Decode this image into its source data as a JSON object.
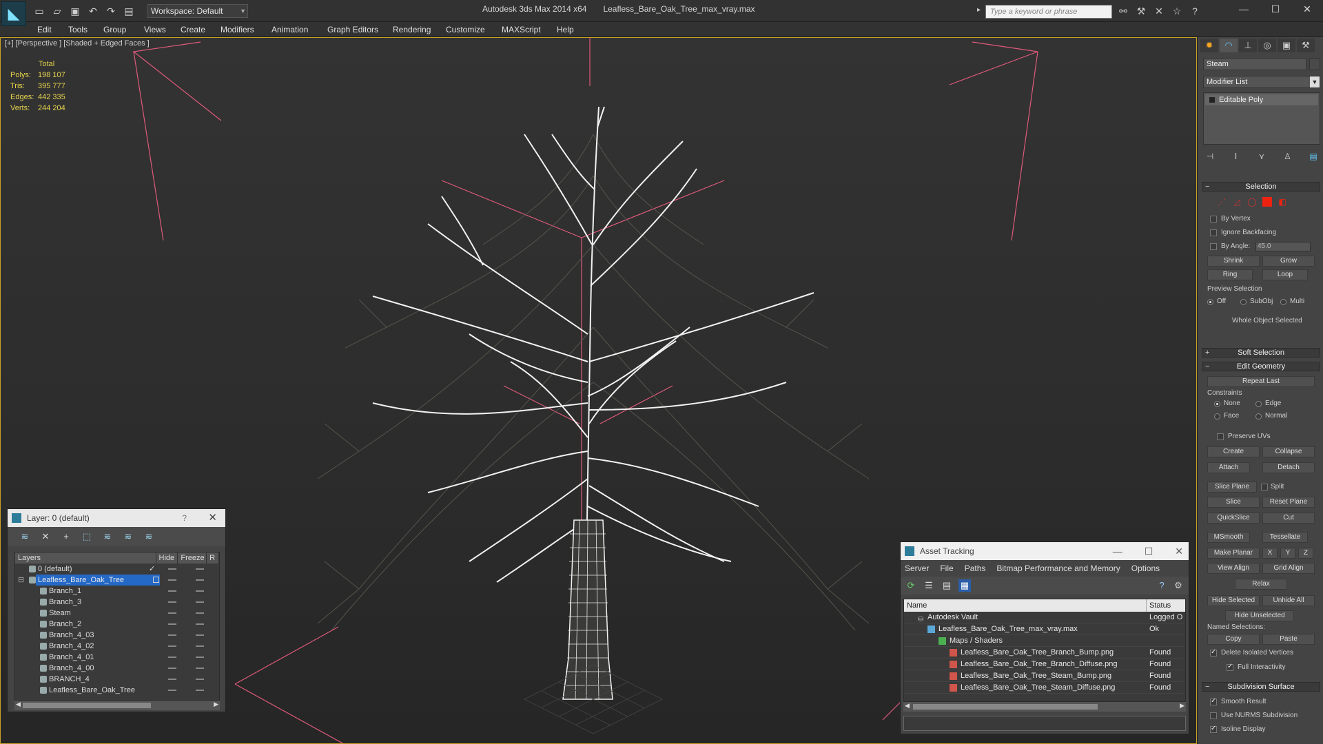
{
  "app": {
    "title": "Autodesk 3ds Max 2014 x64",
    "file": "Leafless_Bare_Oak_Tree_max_vray.max",
    "workspace": "Workspace: Default",
    "search_placeholder": "Type a keyword or phrase"
  },
  "menu": [
    "Edit",
    "Tools",
    "Group",
    "Views",
    "Create",
    "Modifiers",
    "Animation",
    "Graph Editors",
    "Rendering",
    "Customize",
    "MAXScript",
    "Help"
  ],
  "viewport": {
    "label": "[+] [Perspective ] [Shaded + Edged Faces ]",
    "stats": {
      "header": "Total",
      "rows": [
        {
          "k": "Polys:",
          "v": "198 107"
        },
        {
          "k": "Tris:",
          "v": "395 777"
        },
        {
          "k": "Edges:",
          "v": "442 335"
        },
        {
          "k": "Verts:",
          "v": "244 204"
        }
      ]
    }
  },
  "layer_panel": {
    "title": "Layer: 0 (default)",
    "help": "?",
    "columns": [
      "Layers",
      "Hide",
      "Freeze",
      "R"
    ],
    "rows": [
      {
        "name": "0 (default)",
        "level": 1,
        "selected": false
      },
      {
        "name": "Leafless_Bare_Oak_Tree",
        "level": 1,
        "selected": true
      },
      {
        "name": "Branch_1",
        "level": 2,
        "selected": false
      },
      {
        "name": "Branch_3",
        "level": 2,
        "selected": false
      },
      {
        "name": "Steam",
        "level": 2,
        "selected": false
      },
      {
        "name": "Branch_2",
        "level": 2,
        "selected": false
      },
      {
        "name": "Branch_4_03",
        "level": 2,
        "selected": false
      },
      {
        "name": "Branch_4_02",
        "level": 2,
        "selected": false
      },
      {
        "name": "Branch_4_01",
        "level": 2,
        "selected": false
      },
      {
        "name": "Branch_4_00",
        "level": 2,
        "selected": false
      },
      {
        "name": "BRANCH_4",
        "level": 2,
        "selected": false
      },
      {
        "name": "Leafless_Bare_Oak_Tree",
        "level": 2,
        "selected": false
      }
    ]
  },
  "asset_panel": {
    "title": "Asset Tracking",
    "menu": [
      "Server",
      "File",
      "Paths",
      "Bitmap Performance and Memory",
      "Options"
    ],
    "columns": [
      "Name",
      "Status"
    ],
    "rows": [
      {
        "name": "Autodesk Vault",
        "status": "Logged O",
        "level": 1
      },
      {
        "name": "Leafless_Bare_Oak_Tree_max_vray.max",
        "status": "Ok",
        "level": 2
      },
      {
        "name": "Maps / Shaders",
        "status": "",
        "level": 3
      },
      {
        "name": "Leafless_Bare_Oak_Tree_Branch_Bump.png",
        "status": "Found",
        "level": 4
      },
      {
        "name": "Leafless_Bare_Oak_Tree_Branch_Diffuse.png",
        "status": "Found",
        "level": 4
      },
      {
        "name": "Leafless_Bare_Oak_Tree_Steam_Bump.png",
        "status": "Found",
        "level": 4
      },
      {
        "name": "Leafless_Bare_Oak_Tree_Steam_Diffuse.png",
        "status": "Found",
        "level": 4
      }
    ]
  },
  "command_panel": {
    "object_name": "Steam",
    "modifier_list": "Modifier List",
    "stack_item": "Editable Poly",
    "selection": {
      "header": "Selection",
      "by_vertex": "By Vertex",
      "ignore_backfacing": "Ignore Backfacing",
      "by_angle": "By Angle:",
      "angle_value": "45.0",
      "shrink": "Shrink",
      "grow": "Grow",
      "ring": "Ring",
      "loop": "Loop",
      "preview_selection": "Preview Selection",
      "preview_off": "Off",
      "preview_subobj": "SubObj",
      "preview_multi": "Multi",
      "status": "Whole Object Selected"
    },
    "soft_selection": "Soft Selection",
    "edit_geometry": {
      "header": "Edit Geometry",
      "repeat_last": "Repeat Last",
      "constraints": "Constraints",
      "none": "None",
      "edge": "Edge",
      "face": "Face",
      "normal": "Normal",
      "preserve_uvs": "Preserve UVs",
      "create": "Create",
      "collapse": "Collapse",
      "attach": "Attach",
      "detach": "Detach",
      "slice_plane": "Slice Plane",
      "split": "Split",
      "slice": "Slice",
      "reset_plane": "Reset Plane",
      "quickslice": "QuickSlice",
      "cut": "Cut",
      "msmooth": "MSmooth",
      "tessellate": "Tessellate",
      "make_planar": "Make Planar",
      "x": "X",
      "y": "Y",
      "z": "Z",
      "view_align": "View Align",
      "grid_align": "Grid Align",
      "relax": "Relax",
      "hide_selected": "Hide Selected",
      "unhide_all": "Unhide All",
      "hide_unselected": "Hide Unselected",
      "named_selections": "Named Selections:",
      "copy": "Copy",
      "paste": "Paste",
      "delete_isolated": "Delete Isolated Vertices",
      "full_interactivity": "Full Interactivity"
    },
    "subdivision": {
      "header": "Subdivision Surface",
      "smooth_result": "Smooth Result",
      "use_nurms": "Use NURMS Subdivision",
      "isoline": "Isoline Display"
    }
  },
  "colors": {
    "viewport_border": "#c9a227",
    "stats": "#e8d44d",
    "selection_blue": "#2569c7",
    "bounding_box": "#e05a7a"
  }
}
